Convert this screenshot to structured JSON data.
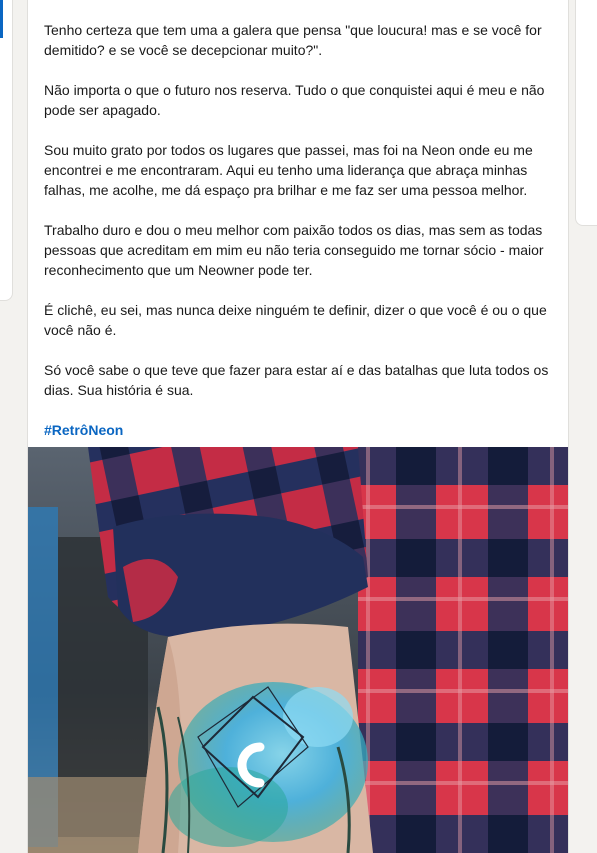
{
  "post": {
    "paragraphs": [
      "Tenho certeza que tem uma a galera que pensa \"que loucura! mas e se você for demitido? e se você se decepcionar muito?\".",
      "Não importa o que o futuro nos reserva. Tudo o que conquistei aqui é meu e não pode ser apagado.",
      "Sou muito grato por todos os lugares que passei, mas foi na Neon onde eu me encontrei e me encontraram. Aqui eu tenho uma liderança que abraça minhas falhas, me acolhe, me dá espaço pra brilhar e me faz ser uma pessoa melhor.",
      "Trabalho duro e dou o meu melhor com paixão todos os dias, mas sem as todas pessoas que acreditam em mim eu não teria conseguido me tornar sócio - maior reconhecimento que um Neowner pode ter.",
      "É clichê, eu sei, mas nunca deixe ninguém te definir, dizer o que você é ou o que você não é.",
      "Só você sabe o que teve que fazer para estar aí e das batalhas que luta todos os dias. Sua história é sua."
    ],
    "hashtag": "#RetrôNeon",
    "image": {
      "subject": "photo-tattoo-arm-plaid-sleeve",
      "colors": {
        "plaid_red": "#d8364a",
        "plaid_navy": "#22305c",
        "skin": "#d9b7a4",
        "tattoo_blue": "#3fb0e0",
        "tattoo_teal": "#2aa89a"
      }
    }
  },
  "theme": {
    "accent": "#0a66c2",
    "page_bg": "#f3f2ef",
    "card_bg": "#ffffff"
  }
}
